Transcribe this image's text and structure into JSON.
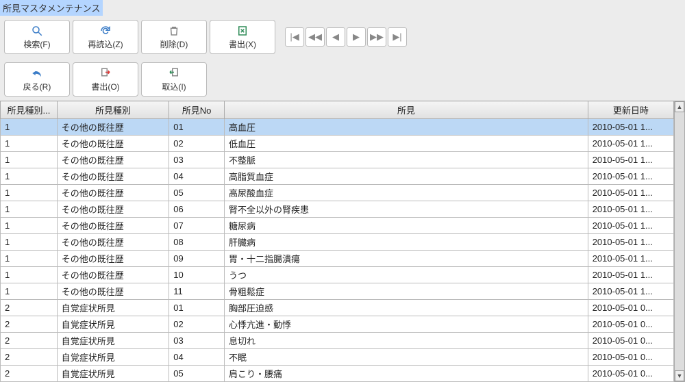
{
  "title": "所見マスタメンテナンス",
  "toolbar1": {
    "search": "検索(F)",
    "reload": "再読込(Z)",
    "delete": "削除(D)",
    "export": "書出(X)"
  },
  "toolbar2": {
    "back": "戻る(R)",
    "export": "書出(O)",
    "import": "取込(I)"
  },
  "columns": {
    "typeNo": "所見種別...",
    "type": "所見種別",
    "no": "所見No",
    "finding": "所見",
    "updated": "更新日時"
  },
  "rows": [
    {
      "typeNo": "1",
      "type": "その他の既往歴",
      "no": "01",
      "finding": "高血圧",
      "updated": "2010-05-01 1...",
      "selected": true
    },
    {
      "typeNo": "1",
      "type": "その他の既往歴",
      "no": "02",
      "finding": "低血圧",
      "updated": "2010-05-01 1..."
    },
    {
      "typeNo": "1",
      "type": "その他の既往歴",
      "no": "03",
      "finding": "不整脈",
      "updated": "2010-05-01 1..."
    },
    {
      "typeNo": "1",
      "type": "その他の既往歴",
      "no": "04",
      "finding": "高脂質血症",
      "updated": "2010-05-01 1..."
    },
    {
      "typeNo": "1",
      "type": "その他の既往歴",
      "no": "05",
      "finding": "高尿酸血症",
      "updated": "2010-05-01 1..."
    },
    {
      "typeNo": "1",
      "type": "その他の既往歴",
      "no": "06",
      "finding": "腎不全以外の腎疾患",
      "updated": "2010-05-01 1..."
    },
    {
      "typeNo": "1",
      "type": "その他の既往歴",
      "no": "07",
      "finding": "糖尿病",
      "updated": "2010-05-01 1..."
    },
    {
      "typeNo": "1",
      "type": "その他の既往歴",
      "no": "08",
      "finding": "肝臓病",
      "updated": "2010-05-01 1..."
    },
    {
      "typeNo": "1",
      "type": "その他の既往歴",
      "no": "09",
      "finding": "胃・十二指腸潰瘍",
      "updated": "2010-05-01 1..."
    },
    {
      "typeNo": "1",
      "type": "その他の既往歴",
      "no": "10",
      "finding": "うつ",
      "updated": "2010-05-01 1..."
    },
    {
      "typeNo": "1",
      "type": "その他の既往歴",
      "no": "11",
      "finding": "骨粗鬆症",
      "updated": "2010-05-01 1..."
    },
    {
      "typeNo": "2",
      "type": "自覚症状所見",
      "no": "01",
      "finding": "胸部圧迫感",
      "updated": "2010-05-01 0..."
    },
    {
      "typeNo": "2",
      "type": "自覚症状所見",
      "no": "02",
      "finding": "心悸亢進・動悸",
      "updated": "2010-05-01 0..."
    },
    {
      "typeNo": "2",
      "type": "自覚症状所見",
      "no": "03",
      "finding": "息切れ",
      "updated": "2010-05-01 0..."
    },
    {
      "typeNo": "2",
      "type": "自覚症状所見",
      "no": "04",
      "finding": "不眠",
      "updated": "2010-05-01 0..."
    },
    {
      "typeNo": "2",
      "type": "自覚症状所見",
      "no": "05",
      "finding": "肩こり・腰痛",
      "updated": "2010-05-01 0..."
    }
  ]
}
